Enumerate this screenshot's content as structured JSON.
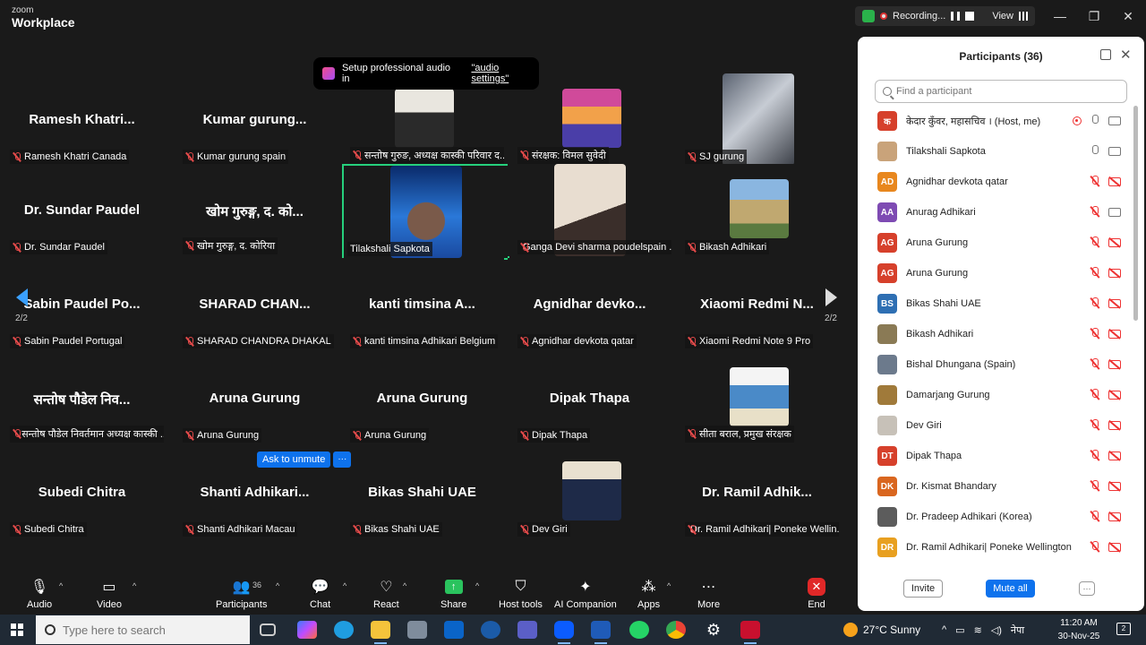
{
  "titlebar": {
    "brand_top": "zoom",
    "brand_bottom": "Workplace",
    "recording_label": "Recording...",
    "view_label": "View",
    "minimize": "—",
    "restore": "❐",
    "close": "✕"
  },
  "banner": {
    "text": "Setup professional audio in",
    "link": "\"audio settings\""
  },
  "tiles": [
    {
      "name": "Ramesh  Khatri...",
      "label": "Ramesh Khatri Canada"
    },
    {
      "name": "Kumar gurung...",
      "label": "Kumar gurung  spain"
    },
    {
      "name": "",
      "label": "सन्तोष गुरुङ, अध्यक्ष कास्की परिवार द..."
    },
    {
      "name": "",
      "label": "संरक्षक: विमल सुवेदी"
    },
    {
      "name": "",
      "label": "SJ gurung"
    },
    {
      "name": "Dr. Sundar Paudel",
      "label": "Dr. Sundar Paudel"
    },
    {
      "name": "खोम गुरुङ्ग, द. को...",
      "label": "खोम गुरुङ्ग, द. कोरिया"
    },
    {
      "name": "",
      "label": "Tilakshali Sapkota"
    },
    {
      "name": "",
      "label": "Ganga Devi sharma poudelspain ..."
    },
    {
      "name": "",
      "label": "Bikash Adhikari"
    },
    {
      "name": "Sabin Paudel Po...",
      "label": "Sabin Paudel Portugal"
    },
    {
      "name": "SHARAD  CHAN...",
      "label": "SHARAD CHANDRA DHAKAL"
    },
    {
      "name": "kanti  timsina  A...",
      "label": "kanti timsina Adhikari Belgium"
    },
    {
      "name": "Agnidhar  devko...",
      "label": "Agnidhar devkota qatar"
    },
    {
      "name": "Xiaomi  Redmi  N...",
      "label": "Xiaomi Redmi Note 9 Pro"
    },
    {
      "name": "सन्तोष पौडेल निव...",
      "label": "सन्तोष पौडेल निवर्तमान अध्यक्ष कास्की ..."
    },
    {
      "name": "Aruna Gurung",
      "label": "Aruna Gurung"
    },
    {
      "name": "Aruna Gurung",
      "label": "Aruna Gurung"
    },
    {
      "name": "Dipak Thapa",
      "label": "Dipak Thapa"
    },
    {
      "name": "",
      "label": "सीता बराल, प्रमुख संरक्षक"
    },
    {
      "name": "Subedi Chitra",
      "label": "Subedi Chitra"
    },
    {
      "name": "Shanti  Adhikari...",
      "label": "Shanti Adhikari Macau"
    },
    {
      "name": "Bikas Shahi UAE",
      "label": "Bikas Shahi UAE"
    },
    {
      "name": "",
      "label": "Dev Giri"
    },
    {
      "name": "Dr. Ramil  Adhik...",
      "label": "Dr. Ramil Adhikari| Poneke Wellin..."
    }
  ],
  "pager": {
    "left": "2/2",
    "right": "2/2"
  },
  "unmute": {
    "label": "Ask to unmute",
    "more": "···"
  },
  "panel": {
    "title": "Participants (36)",
    "search_placeholder": "Find a participant",
    "invite": "Invite",
    "mute_all": "Mute all",
    "more": "···",
    "participants": [
      {
        "initials": "क",
        "name": "केदार कुँवर, महासचिव । (Host, me)",
        "color": "#d6402b"
      },
      {
        "initials": "",
        "name": "Tilakshali Sapkota",
        "color": "#c9a37a"
      },
      {
        "initials": "AD",
        "name": "Agnidhar devkota qatar",
        "color": "#e8871e"
      },
      {
        "initials": "AA",
        "name": "Anurag Adhikari",
        "color": "#7e4bb3"
      },
      {
        "initials": "AG",
        "name": "Aruna Gurung",
        "color": "#d6402b"
      },
      {
        "initials": "AG",
        "name": "Aruna Gurung",
        "color": "#d6402b"
      },
      {
        "initials": "BS",
        "name": "Bikas Shahi UAE",
        "color": "#2e6fb3"
      },
      {
        "initials": "",
        "name": "Bikash Adhikari",
        "color": "#8a7a55"
      },
      {
        "initials": "",
        "name": "Bishal Dhungana (Spain)",
        "color": "#6c7a8c"
      },
      {
        "initials": "",
        "name": "Damarjang Gurung",
        "color": "#a07a3a"
      },
      {
        "initials": "",
        "name": "Dev Giri",
        "color": "#c7c1b8"
      },
      {
        "initials": "DT",
        "name": "Dipak Thapa",
        "color": "#d6402b"
      },
      {
        "initials": "DK",
        "name": "Dr. Kismat Bhandary",
        "color": "#d9661f"
      },
      {
        "initials": "",
        "name": "Dr. Pradeep Adhikari (Korea)",
        "color": "#5c5c5c"
      },
      {
        "initials": "DR",
        "name": "Dr. Ramil Adhikari| Poneke Wellington",
        "color": "#e8a020"
      }
    ]
  },
  "toolbar": {
    "audio": "Audio",
    "video": "Video",
    "participants": "Participants",
    "participants_count": "36",
    "chat": "Chat",
    "react": "React",
    "share": "Share",
    "host_tools": "Host tools",
    "ai_companion": "AI Companion",
    "apps": "Apps",
    "more": "More",
    "end": "End"
  },
  "taskbar": {
    "search_placeholder": "Type here to search",
    "weather": "27°C  Sunny",
    "language": "नेपा",
    "time": "11:20 AM",
    "date": "30-Nov-25",
    "notifications": "2"
  }
}
